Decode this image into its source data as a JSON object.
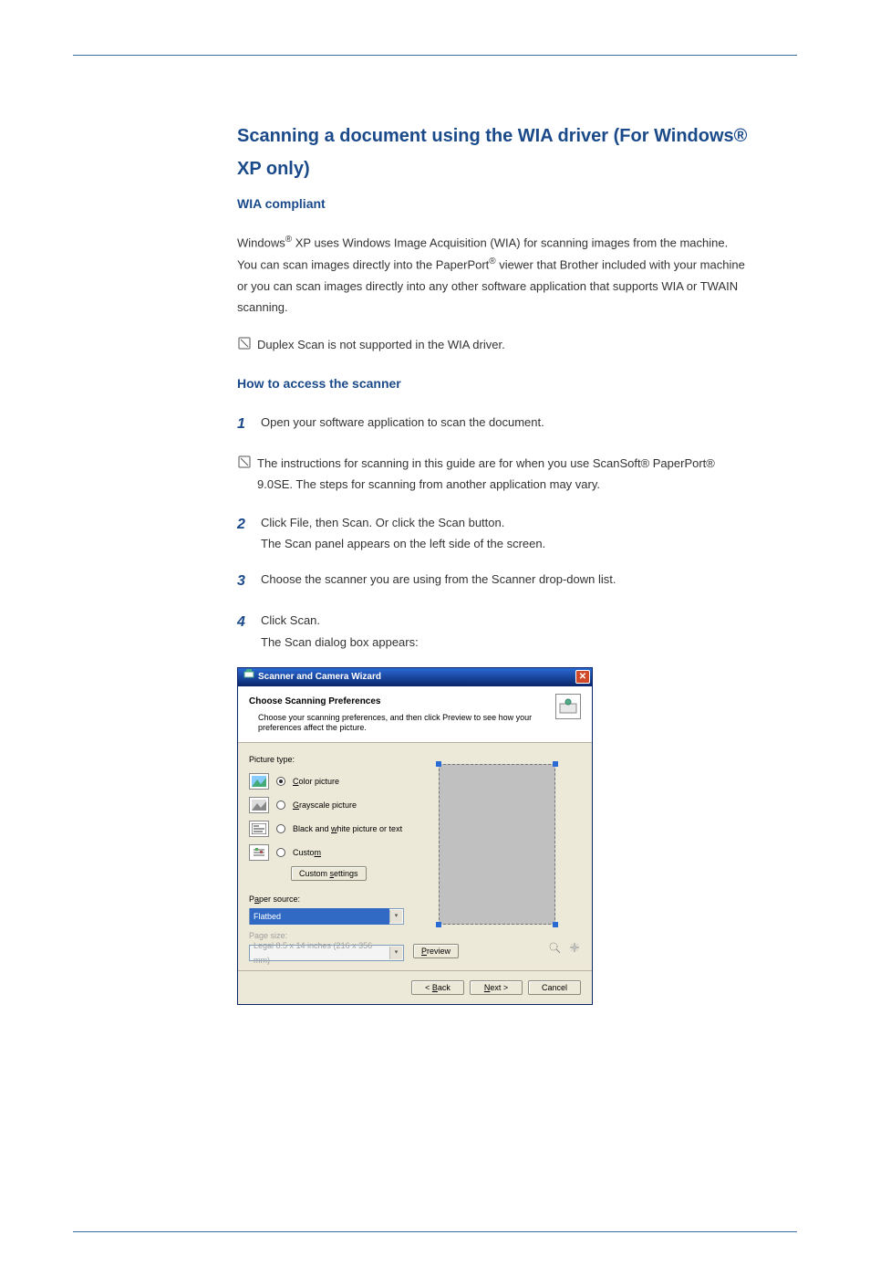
{
  "heading": "Scanning a document using the WIA driver (For Windows® XP only)",
  "subheading": "WIA compliant",
  "para1_pre": "Windows",
  "para1_post": " XP uses Windows Image Acquisition (WIA) for scanning images from the machine. You can scan images directly into the PaperPort",
  "para1_after": " viewer that Brother included with your machine or you can scan images directly into any other software application that supports WIA or TWAIN scanning.",
  "note": "Duplex Scan is not supported in the WIA driver.",
  "section2": "How to access the scanner",
  "steps": [
    "Open your software application to scan the document.",
    "The instructions for scanning in this guide are for when you use ScanSoft® PaperPort® 9.0SE. The steps for scanning from another application may vary.",
    "Click File, then Scan. Or click the Scan button.\nThe Scan panel appears on the left side of the screen.",
    "Choose the scanner you are using from the Scanner drop-down list.",
    "Click Scan.\nThe Scan dialog box appears:"
  ],
  "wizard": {
    "title": "Scanner and Camera Wizard",
    "header_title": "Choose Scanning Preferences",
    "header_sub": "Choose your scanning preferences, and then click Preview to see how your preferences affect the picture.",
    "picture_type_label": "Picture type:",
    "options": {
      "color": "Color picture",
      "gray": "Grayscale picture",
      "bw": "Black and white picture or text",
      "custom": "Custom"
    },
    "custom_settings": "Custom settings",
    "paper_source_label": "Paper source:",
    "paper_source_value": "Flatbed",
    "page_size_label": "Page size:",
    "page_size_value": "Legal 8.5 x 14 inches (216 x 356 mm)",
    "preview_btn": "Preview",
    "back_btn": "< Back",
    "next_btn": "Next >",
    "cancel_btn": "Cancel"
  }
}
